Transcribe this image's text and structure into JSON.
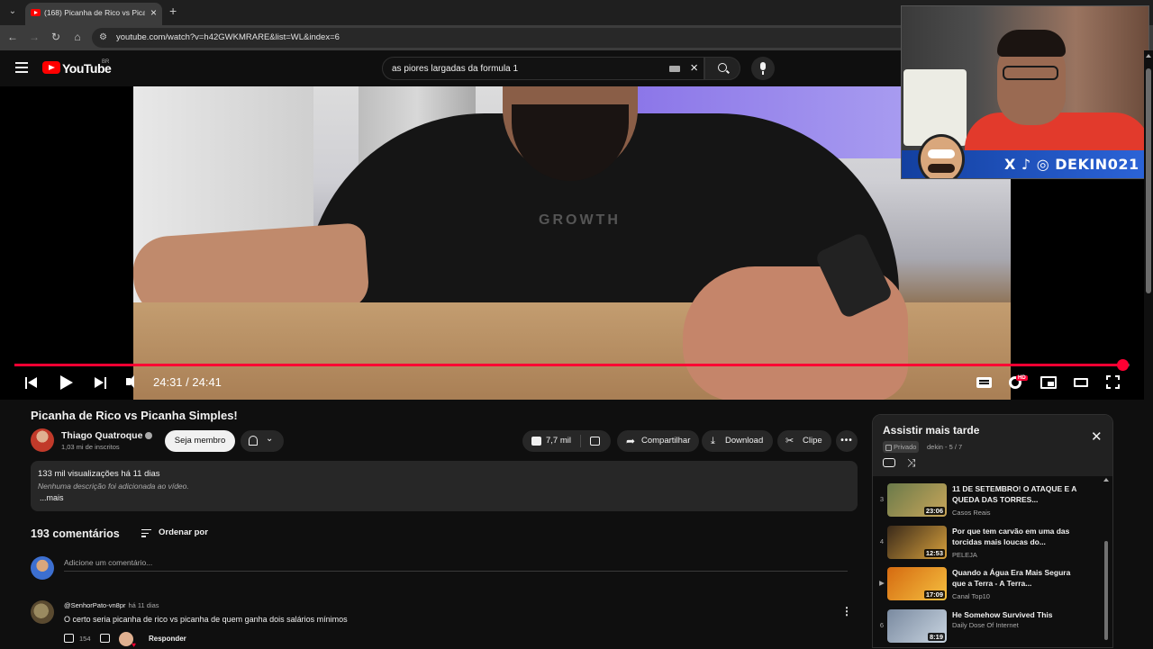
{
  "browser": {
    "tab_title": "(168) Picanha de Rico vs Picanha",
    "url": "youtube.com/watch?v=h42GWKMRARE&list=WL&index=6"
  },
  "header": {
    "logo_text": "YouTube",
    "country": "BR",
    "search_value": "as piores largadas da formula 1"
  },
  "player": {
    "progress_fraction": 0.9932,
    "time": "24:31 / 24:41",
    "hd_badge": "HD"
  },
  "video": {
    "print_text": "GROWTH",
    "title": "Picanha de Rico vs Picanha Simples!",
    "channel": "Thiago Quatroque",
    "subscribers": "1,03 mi de inscritos",
    "member_label": "Seja membro",
    "likes": "7,7 mil",
    "share_label": "Compartilhar",
    "download_label": "Download",
    "clip_label": "Clipe",
    "more_label": "•••"
  },
  "description": {
    "views": "133 mil visualizações  há 11 dias",
    "empty": "Nenhuma descrição foi adicionada ao vídeo.",
    "more": "...mais"
  },
  "comments": {
    "count": "193 comentários",
    "sort_label": "Ordenar por",
    "add_placeholder": "Adicione um comentário...",
    "items": [
      {
        "author": "@SenhorPato-vn8pr",
        "ago": "há 11 dias",
        "text": "O certo seria picanha de rico vs picanha de quem ganha dois salários mínimos",
        "likes": "154",
        "reply": "Responder"
      }
    ]
  },
  "webcam": {
    "handle": "DEKIN021",
    "socials": "X ♪ ◎"
  },
  "playlist": {
    "title": "Assistir mais tarde",
    "privacy": "Privado",
    "meta": "dekin - 5 / 7",
    "items": [
      {
        "index": "3",
        "title": "11 DE SETEMBRO! O ATAQUE E A QUEDA DAS TORRES...",
        "channel": "Casos Reais",
        "duration": "23:06",
        "colors": [
          "#6a7a4a",
          "#c9a65a"
        ]
      },
      {
        "index": "4",
        "title": "Por que tem carvão em uma das torcidas mais loucas do...",
        "channel": "PELEJA",
        "duration": "12:53",
        "colors": [
          "#3a2a1a",
          "#d7a03c"
        ]
      },
      {
        "index": "▶",
        "title": "Quando a Água Era Mais Segura que a Terra - A Terra...",
        "channel": "Canal Top10",
        "duration": "17:09",
        "colors": [
          "#d56a10",
          "#f5c040"
        ]
      },
      {
        "index": "6",
        "title": "He Somehow Survived This",
        "channel": "Daily Dose Of Internet",
        "duration": "8:19",
        "colors": [
          "#7a8aa0",
          "#c8d4e0"
        ]
      }
    ]
  }
}
